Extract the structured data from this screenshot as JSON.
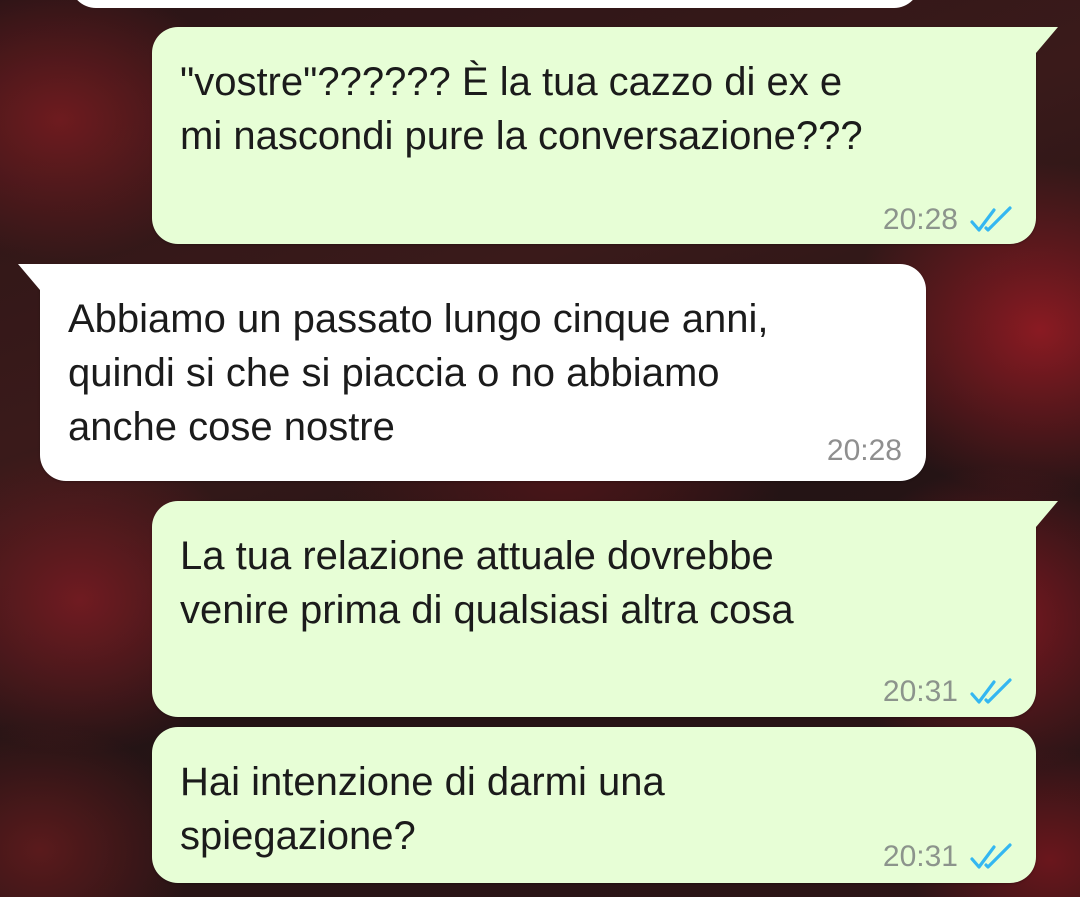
{
  "messages": [
    {
      "direction": "outgoing",
      "text": "\"vostre\"?????? È la tua cazzo di ex e\nmi nascondi pure la conversazione???",
      "time": "20:28",
      "status": "read"
    },
    {
      "direction": "incoming",
      "text": "Abbiamo un passato lungo cinque anni,\nquindi si che si piaccia o no abbiamo\nanche cose nostre",
      "time": "20:28"
    },
    {
      "direction": "outgoing",
      "text": "La tua relazione attuale dovrebbe\nvenire prima di qualsiasi altra cosa",
      "time": "20:31",
      "status": "read"
    },
    {
      "direction": "outgoing",
      "text": "Hai intenzione di darmi una\nspiegazione?",
      "time": "20:31",
      "status": "read"
    }
  ],
  "colors": {
    "outgoing_bubble": "#e7fed6",
    "incoming_bubble": "#ffffff",
    "read_ticks": "#34b7f1",
    "timestamp": "#8c948c"
  },
  "icons": {
    "read_receipt": "double-check-icon"
  }
}
